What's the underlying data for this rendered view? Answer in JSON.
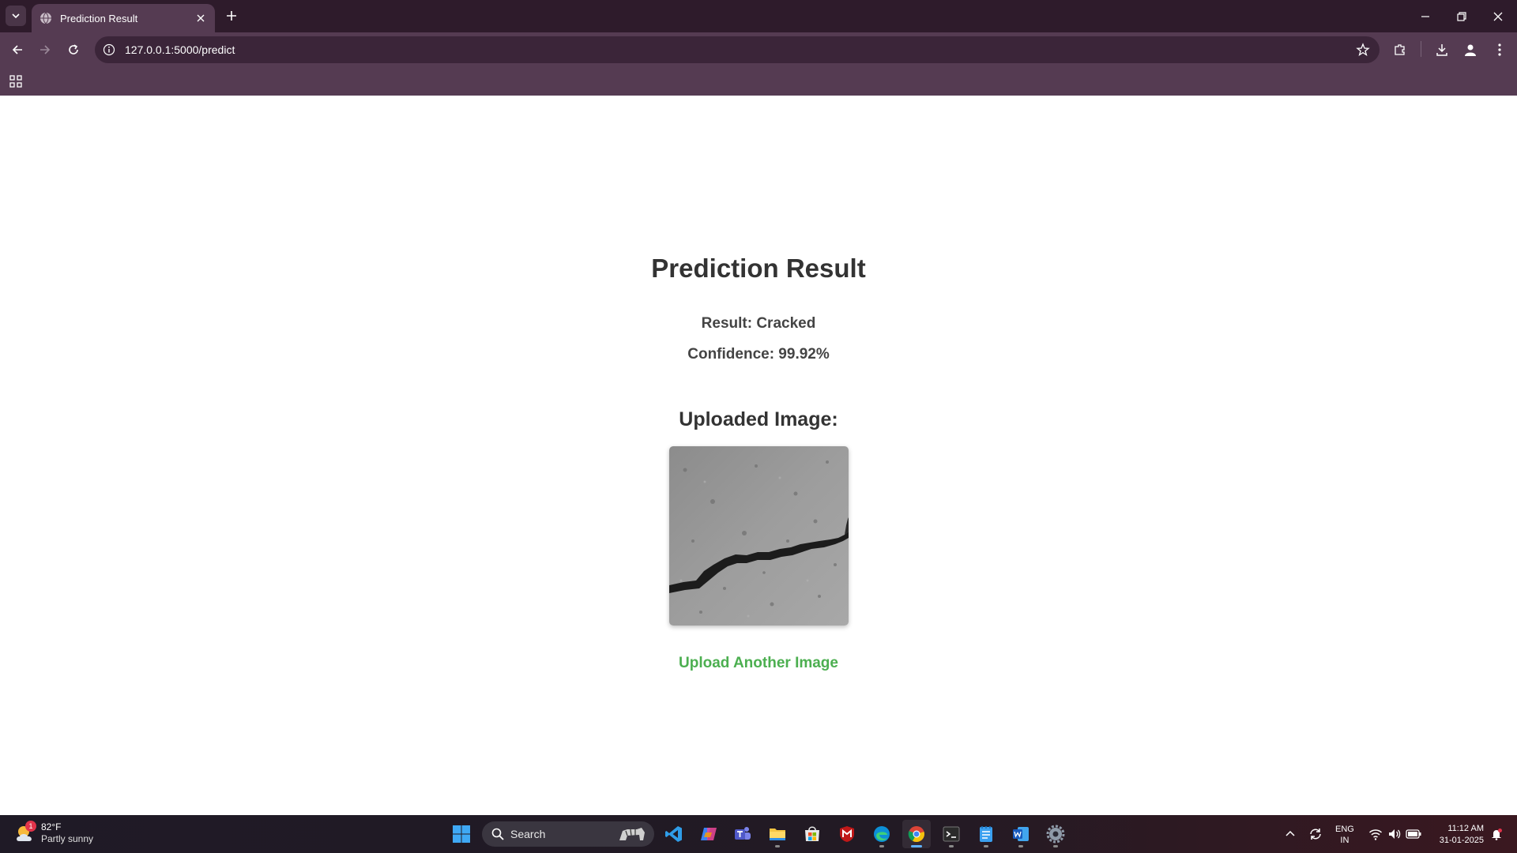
{
  "browser": {
    "tab_title": "Prediction Result",
    "url": "127.0.0.1:5000/predict"
  },
  "page": {
    "title": "Prediction Result",
    "result": "Result: Cracked",
    "confidence": "Confidence: 99.92%",
    "image_heading": "Uploaded Image:",
    "link_label": "Upload Another Image",
    "link_color": "#4caf50",
    "image_alt": "uploaded concrete image"
  },
  "taskbar": {
    "weather_temp": "82°F",
    "weather_cond": "Partly sunny",
    "weather_badge": "1",
    "search_label": "Search",
    "apps": [
      "vscode-icon",
      "copilot-icon",
      "teams-icon",
      "file-explorer-icon",
      "store-icon",
      "mcafee-icon",
      "edge-icon",
      "chrome-icon",
      "terminal-icon",
      "notepad-icon",
      "word-icon",
      "settings-icon"
    ],
    "lang_top": "ENG",
    "lang_bottom": "IN",
    "time": "11:12 AM",
    "date": "31-01-2025"
  },
  "colors": {
    "tabstrip": "#2e1b2b",
    "toolbar": "#553b52",
    "accent_green": "#4caf50"
  }
}
